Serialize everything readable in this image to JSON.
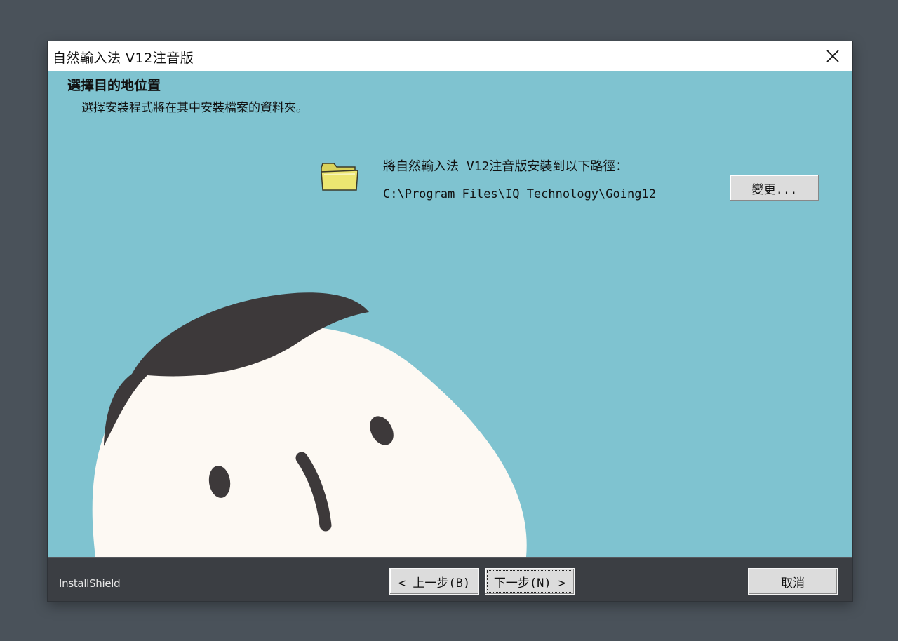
{
  "window": {
    "title": "自然輸入法 V12注音版"
  },
  "header": {
    "heading": "選擇目的地位置",
    "subheading": "選擇安裝程式將在其中安裝檔案的資料夾。"
  },
  "destination": {
    "label": "將自然輸入法 V12注音版安裝到以下路徑：",
    "path": "C:\\Program Files\\IQ Technology\\Going12",
    "change_label": "變更..."
  },
  "footer": {
    "brand": "InstallShield",
    "back_label": "< 上一步(B)",
    "next_label": "下一步(N) >",
    "cancel_label": "取消"
  },
  "icons": {
    "close": "close-icon",
    "folder": "folder-icon"
  },
  "colors": {
    "background": "#7fc3d0",
    "footer": "#3b3e43",
    "face": "#fdf9f3",
    "hair": "#3d393a",
    "folder": "#e6e06a"
  }
}
